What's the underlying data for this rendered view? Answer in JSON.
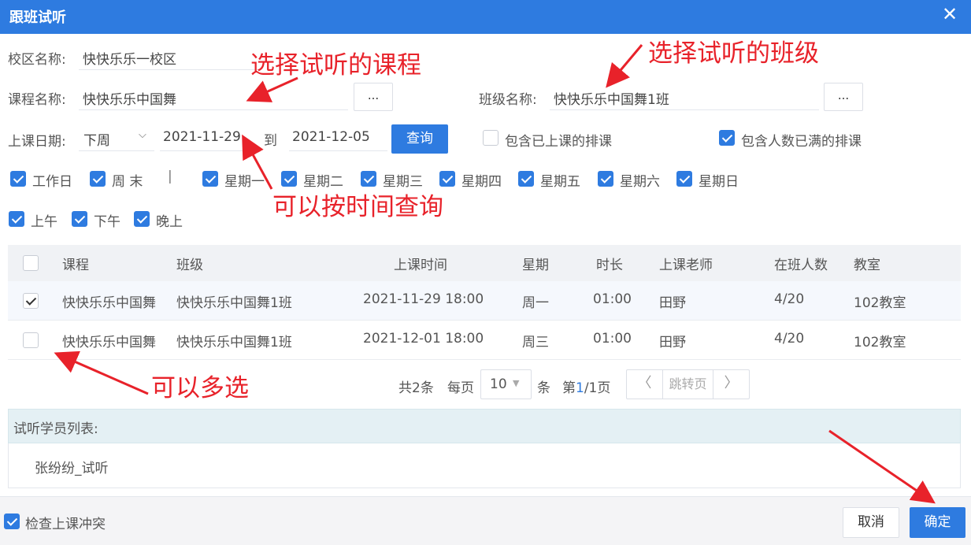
{
  "dialog": {
    "title": "跟班试听"
  },
  "form": {
    "campus_label": "校区名称:",
    "campus_value": "快快乐乐一校区",
    "course_label": "课程名称:",
    "course_value": "快快乐乐中国舞",
    "class_label": "班级名称:",
    "class_value": "快快乐乐中国舞1班",
    "picker_label": "...",
    "date_label": "上课日期:",
    "date_range_select": "下周",
    "date_from": "2021-11-29",
    "date_to_sep": "到",
    "date_to": "2021-12-05",
    "query_button": "查询",
    "include_past_label": "包含已上课的排课",
    "include_past_checked": false,
    "include_full_label": "包含人数已满的排课",
    "include_full_checked": true
  },
  "day_filters": [
    {
      "label": "工作日",
      "checked": true
    },
    {
      "label": "周 末",
      "checked": true
    },
    {
      "label": "星期一",
      "checked": true
    },
    {
      "label": "星期二",
      "checked": true
    },
    {
      "label": "星期三",
      "checked": true
    },
    {
      "label": "星期四",
      "checked": true
    },
    {
      "label": "星期五",
      "checked": true
    },
    {
      "label": "星期六",
      "checked": true
    },
    {
      "label": "星期日",
      "checked": true
    }
  ],
  "divider_text": "|",
  "time_filters": [
    {
      "label": "上午",
      "checked": true
    },
    {
      "label": "下午",
      "checked": true
    },
    {
      "label": "晚上",
      "checked": true
    }
  ],
  "table": {
    "headers": [
      "课程",
      "班级",
      "上课时间",
      "星期",
      "时长",
      "上课老师",
      "在班人数",
      "教室"
    ],
    "rows": [
      {
        "checked": true,
        "cells": [
          "快快乐乐中国舞",
          "快快乐乐中国舞1班",
          "2021-11-29 18:00",
          "周一",
          "01:00",
          "田野",
          "4/20",
          "102教室"
        ]
      },
      {
        "checked": false,
        "cells": [
          "快快乐乐中国舞",
          "快快乐乐中国舞1班",
          "2021-12-01 18:00",
          "周三",
          "01:00",
          "田野",
          "4/20",
          "102教室"
        ]
      }
    ]
  },
  "pagination": {
    "total": "共2条",
    "per_page_label": "每页",
    "per_page_value": "10",
    "unit": "条",
    "page_prefix": "第",
    "page_current": "1",
    "page_suffix": "/1页",
    "jump_placeholder": "跳转页"
  },
  "students": {
    "header": "试听学员列表:",
    "items": [
      "张纷纷_试听"
    ]
  },
  "footer": {
    "conflict_label": "检查上课冲突",
    "conflict_checked": true,
    "cancel": "取消",
    "ok": "确定"
  },
  "annotations": {
    "select_course": "选择试听的课程",
    "select_class": "选择试听的班级",
    "by_time": "可以按时间查询",
    "multi": "可以多选"
  },
  "colors": {
    "primary": "#2e7be0",
    "annotation": "#e8222a"
  }
}
